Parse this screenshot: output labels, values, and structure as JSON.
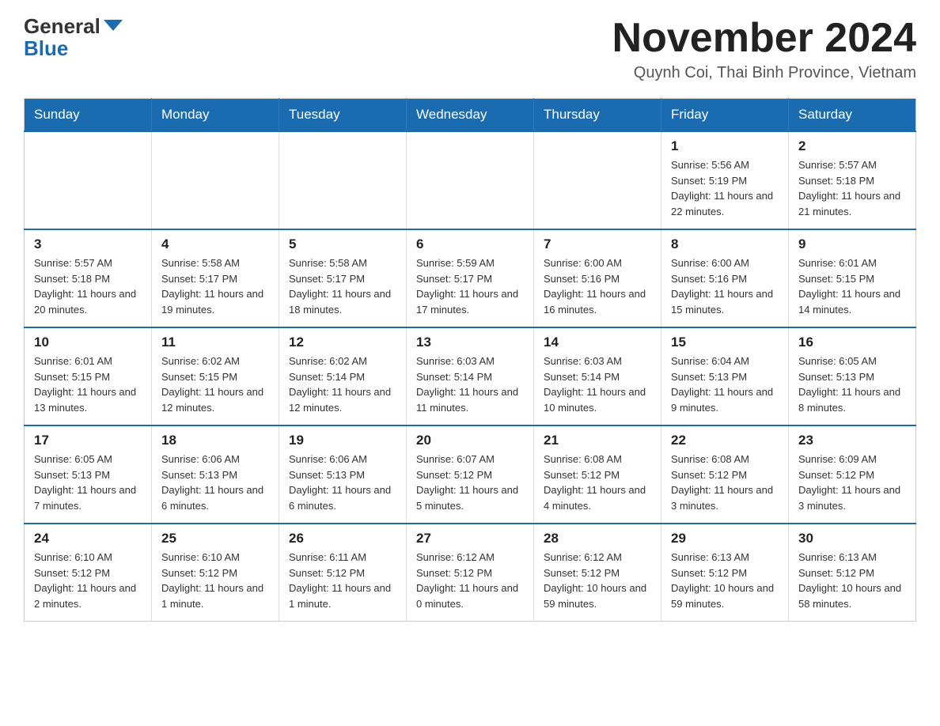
{
  "header": {
    "logo_general": "General",
    "logo_blue": "Blue",
    "month_title": "November 2024",
    "location": "Quynh Coi, Thai Binh Province, Vietnam"
  },
  "weekdays": [
    "Sunday",
    "Monday",
    "Tuesday",
    "Wednesday",
    "Thursday",
    "Friday",
    "Saturday"
  ],
  "weeks": [
    [
      {
        "day": "",
        "info": ""
      },
      {
        "day": "",
        "info": ""
      },
      {
        "day": "",
        "info": ""
      },
      {
        "day": "",
        "info": ""
      },
      {
        "day": "",
        "info": ""
      },
      {
        "day": "1",
        "info": "Sunrise: 5:56 AM\nSunset: 5:19 PM\nDaylight: 11 hours and 22 minutes."
      },
      {
        "day": "2",
        "info": "Sunrise: 5:57 AM\nSunset: 5:18 PM\nDaylight: 11 hours and 21 minutes."
      }
    ],
    [
      {
        "day": "3",
        "info": "Sunrise: 5:57 AM\nSunset: 5:18 PM\nDaylight: 11 hours and 20 minutes."
      },
      {
        "day": "4",
        "info": "Sunrise: 5:58 AM\nSunset: 5:17 PM\nDaylight: 11 hours and 19 minutes."
      },
      {
        "day": "5",
        "info": "Sunrise: 5:58 AM\nSunset: 5:17 PM\nDaylight: 11 hours and 18 minutes."
      },
      {
        "day": "6",
        "info": "Sunrise: 5:59 AM\nSunset: 5:17 PM\nDaylight: 11 hours and 17 minutes."
      },
      {
        "day": "7",
        "info": "Sunrise: 6:00 AM\nSunset: 5:16 PM\nDaylight: 11 hours and 16 minutes."
      },
      {
        "day": "8",
        "info": "Sunrise: 6:00 AM\nSunset: 5:16 PM\nDaylight: 11 hours and 15 minutes."
      },
      {
        "day": "9",
        "info": "Sunrise: 6:01 AM\nSunset: 5:15 PM\nDaylight: 11 hours and 14 minutes."
      }
    ],
    [
      {
        "day": "10",
        "info": "Sunrise: 6:01 AM\nSunset: 5:15 PM\nDaylight: 11 hours and 13 minutes."
      },
      {
        "day": "11",
        "info": "Sunrise: 6:02 AM\nSunset: 5:15 PM\nDaylight: 11 hours and 12 minutes."
      },
      {
        "day": "12",
        "info": "Sunrise: 6:02 AM\nSunset: 5:14 PM\nDaylight: 11 hours and 12 minutes."
      },
      {
        "day": "13",
        "info": "Sunrise: 6:03 AM\nSunset: 5:14 PM\nDaylight: 11 hours and 11 minutes."
      },
      {
        "day": "14",
        "info": "Sunrise: 6:03 AM\nSunset: 5:14 PM\nDaylight: 11 hours and 10 minutes."
      },
      {
        "day": "15",
        "info": "Sunrise: 6:04 AM\nSunset: 5:13 PM\nDaylight: 11 hours and 9 minutes."
      },
      {
        "day": "16",
        "info": "Sunrise: 6:05 AM\nSunset: 5:13 PM\nDaylight: 11 hours and 8 minutes."
      }
    ],
    [
      {
        "day": "17",
        "info": "Sunrise: 6:05 AM\nSunset: 5:13 PM\nDaylight: 11 hours and 7 minutes."
      },
      {
        "day": "18",
        "info": "Sunrise: 6:06 AM\nSunset: 5:13 PM\nDaylight: 11 hours and 6 minutes."
      },
      {
        "day": "19",
        "info": "Sunrise: 6:06 AM\nSunset: 5:13 PM\nDaylight: 11 hours and 6 minutes."
      },
      {
        "day": "20",
        "info": "Sunrise: 6:07 AM\nSunset: 5:12 PM\nDaylight: 11 hours and 5 minutes."
      },
      {
        "day": "21",
        "info": "Sunrise: 6:08 AM\nSunset: 5:12 PM\nDaylight: 11 hours and 4 minutes."
      },
      {
        "day": "22",
        "info": "Sunrise: 6:08 AM\nSunset: 5:12 PM\nDaylight: 11 hours and 3 minutes."
      },
      {
        "day": "23",
        "info": "Sunrise: 6:09 AM\nSunset: 5:12 PM\nDaylight: 11 hours and 3 minutes."
      }
    ],
    [
      {
        "day": "24",
        "info": "Sunrise: 6:10 AM\nSunset: 5:12 PM\nDaylight: 11 hours and 2 minutes."
      },
      {
        "day": "25",
        "info": "Sunrise: 6:10 AM\nSunset: 5:12 PM\nDaylight: 11 hours and 1 minute."
      },
      {
        "day": "26",
        "info": "Sunrise: 6:11 AM\nSunset: 5:12 PM\nDaylight: 11 hours and 1 minute."
      },
      {
        "day": "27",
        "info": "Sunrise: 6:12 AM\nSunset: 5:12 PM\nDaylight: 11 hours and 0 minutes."
      },
      {
        "day": "28",
        "info": "Sunrise: 6:12 AM\nSunset: 5:12 PM\nDaylight: 10 hours and 59 minutes."
      },
      {
        "day": "29",
        "info": "Sunrise: 6:13 AM\nSunset: 5:12 PM\nDaylight: 10 hours and 59 minutes."
      },
      {
        "day": "30",
        "info": "Sunrise: 6:13 AM\nSunset: 5:12 PM\nDaylight: 10 hours and 58 minutes."
      }
    ]
  ]
}
